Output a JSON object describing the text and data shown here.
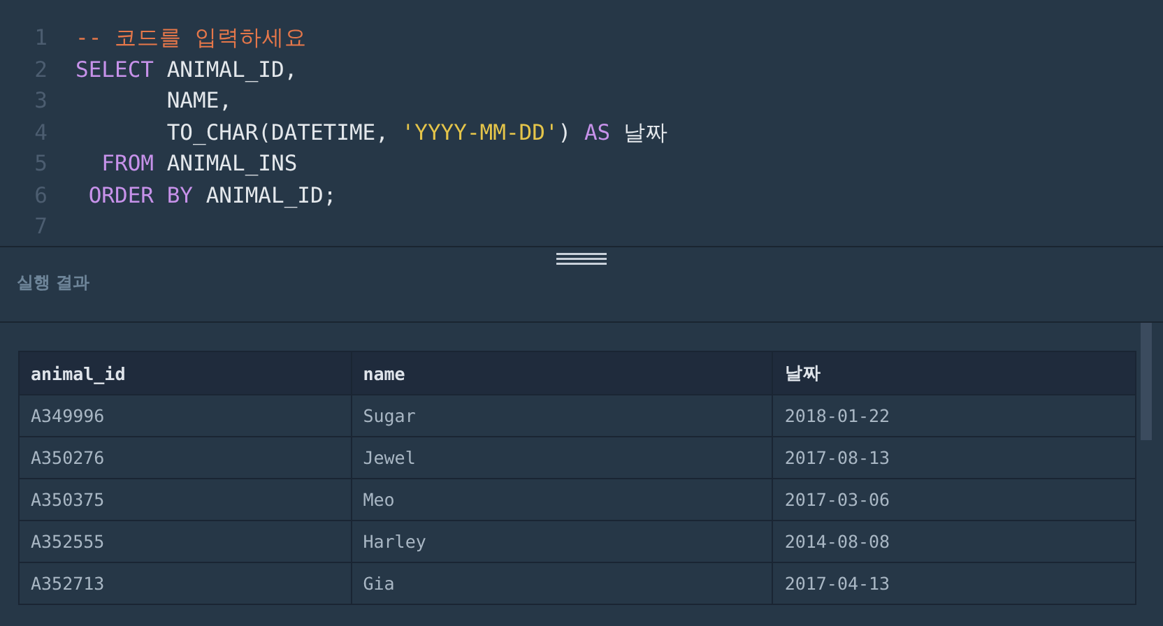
{
  "editor": {
    "lines": [
      {
        "number": "1",
        "tokens": [
          {
            "kind": "comment",
            "text": "-- 코드를 입력하세요"
          }
        ]
      },
      {
        "number": "2",
        "tokens": [
          {
            "kind": "keyword",
            "text": "SELECT"
          },
          {
            "kind": "plain",
            "text": " ANIMAL_ID,"
          }
        ]
      },
      {
        "number": "3",
        "tokens": [
          {
            "kind": "plain",
            "text": "       NAME,"
          }
        ]
      },
      {
        "number": "4",
        "tokens": [
          {
            "kind": "plain",
            "text": "       TO_CHAR(DATETIME, "
          },
          {
            "kind": "string",
            "text": "'YYYY-MM-DD'"
          },
          {
            "kind": "plain",
            "text": ") "
          },
          {
            "kind": "keyword",
            "text": "AS"
          },
          {
            "kind": "plain",
            "text": " 날짜"
          }
        ]
      },
      {
        "number": "5",
        "tokens": [
          {
            "kind": "keyword",
            "text": "  FROM"
          },
          {
            "kind": "plain",
            "text": " ANIMAL_INS"
          }
        ]
      },
      {
        "number": "6",
        "tokens": [
          {
            "kind": "keyword",
            "text": " ORDER BY"
          },
          {
            "kind": "plain",
            "text": " ANIMAL_ID;"
          }
        ]
      },
      {
        "number": "7"
      }
    ]
  },
  "result": {
    "title": "실행 결과",
    "table": {
      "columns": [
        "animal_id",
        "name",
        "날짜"
      ],
      "rows": [
        [
          "A349996",
          "Sugar",
          "2018-01-22"
        ],
        [
          "A350276",
          "Jewel",
          "2017-08-13"
        ],
        [
          "A350375",
          "Meo",
          "2017-03-06"
        ],
        [
          "A352555",
          "Harley",
          "2014-08-08"
        ],
        [
          "A352713",
          "Gia",
          "2017-04-13"
        ]
      ]
    }
  }
}
